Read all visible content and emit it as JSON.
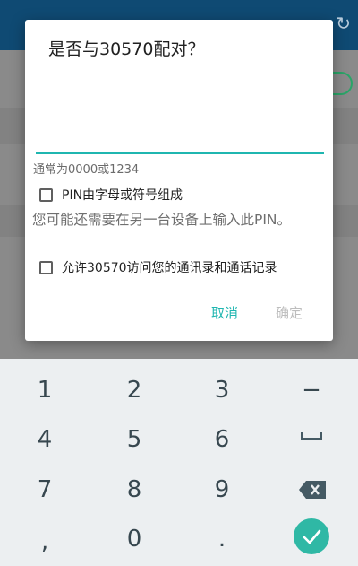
{
  "dialog": {
    "title": "是否与30570配对？",
    "pin_value": "",
    "pin_hint": "通常为0000或1234",
    "alphanumeric_label": "PIN由字母或符号组成",
    "note": "您可能还需要在另一台设备上输入此PIN。",
    "contacts_label": "允许30570访问您的通讯录和通话记录",
    "cancel_label": "取消",
    "ok_label": "确定"
  },
  "keyboard": {
    "row1": [
      "1",
      "2",
      "3",
      "−"
    ],
    "row2": [
      "4",
      "5",
      "6"
    ],
    "row3": [
      "7",
      "8",
      "9"
    ],
    "row4": [
      ",",
      "0",
      "."
    ],
    "space_icon": "space-icon",
    "backspace_icon": "backspace-icon",
    "done_icon": "check-icon"
  },
  "colors": {
    "accent": "#1fb6b0",
    "done_key": "#2fb8a5",
    "app_bar": "#0f4a73"
  }
}
